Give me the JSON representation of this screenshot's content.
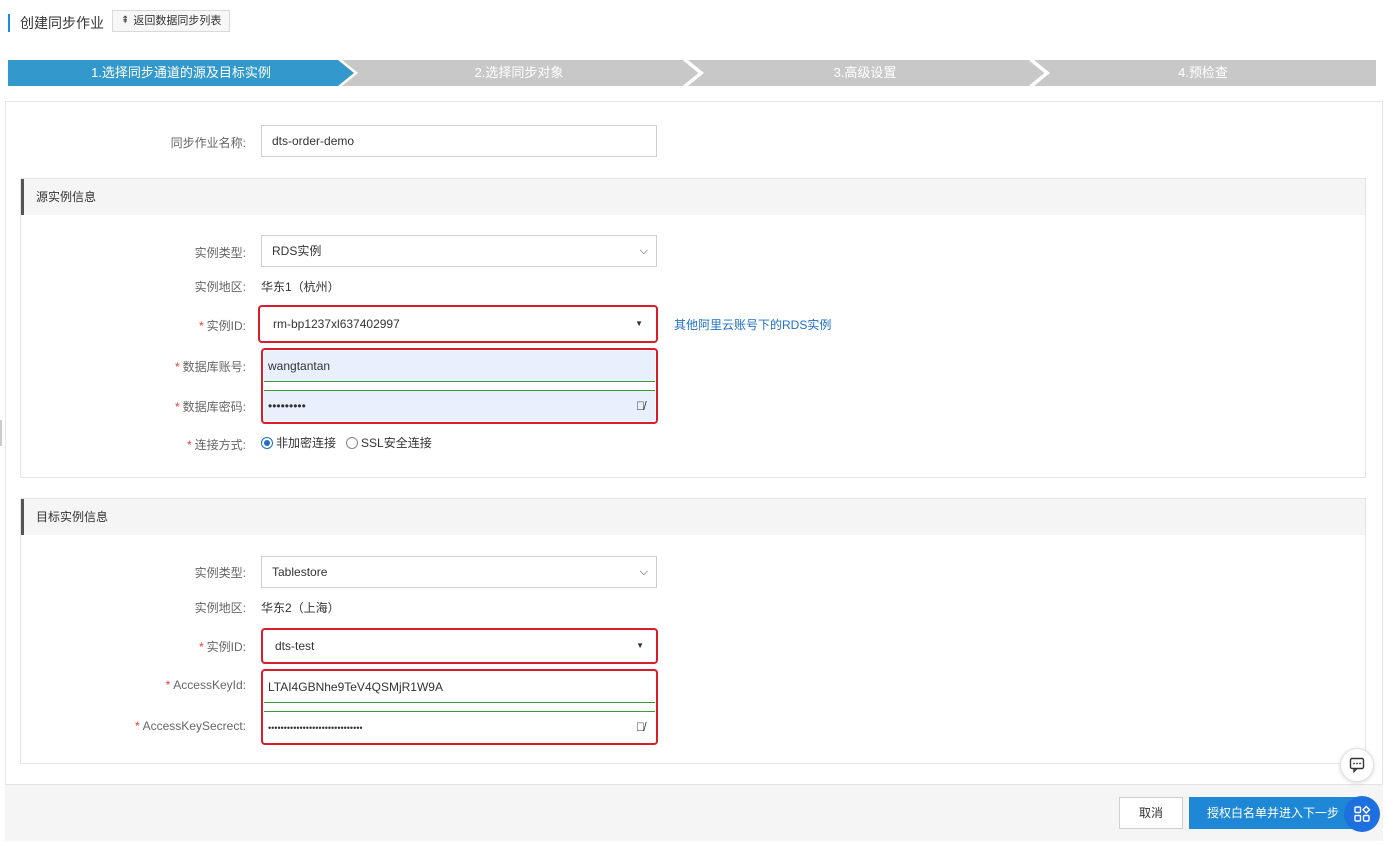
{
  "header": {
    "title": "创建同步作业",
    "back_label": "返回数据同步列表",
    "back_icon": "upload-arrow-icon"
  },
  "steps": [
    {
      "label": "1.选择同步通道的源及目标实例",
      "active": true
    },
    {
      "label": "2.选择同步对象",
      "active": false
    },
    {
      "label": "3.高级设置",
      "active": false
    },
    {
      "label": "4.预检查",
      "active": false
    }
  ],
  "colors": {
    "step_active": "#3399cc",
    "step_inactive": "#c8c8c8",
    "highlight_border": "#d91d2a",
    "primary_button": "#1e88d6",
    "link": "#1e6fc8"
  },
  "job": {
    "name_label": "同步作业名称:",
    "name_value": "dts-order-demo"
  },
  "source": {
    "section_title": "源实例信息",
    "type_label": "实例类型:",
    "type_value": "RDS实例",
    "region_label": "实例地区:",
    "region_value": "华东1（杭州）",
    "id_label": "实例ID:",
    "id_value": "rm-bp1237xl637402997",
    "other_account_link": "其他阿里云账号下的RDS实例",
    "account_label": "数据库账号:",
    "account_value": "wangtantan",
    "password_label": "数据库密码:",
    "password_value": "•••••••••",
    "connection_label": "连接方式:",
    "connection_options": [
      "非加密连接",
      "SSL安全连接"
    ],
    "connection_selected": "非加密连接"
  },
  "target": {
    "section_title": "目标实例信息",
    "type_label": "实例类型:",
    "type_value": "Tablestore",
    "region_label": "实例地区:",
    "region_value": "华东2（上海）",
    "id_label": "实例ID:",
    "id_value": "dts-test",
    "access_key_id_label": "AccessKeyId:",
    "access_key_id_value": "LTAI4GBNhe9TeV4QSMjR1W9A",
    "access_key_secret_label": "AccessKeySecrect:",
    "access_key_secret_value": "••••••••••••••••••••••••••••••"
  },
  "footer": {
    "cancel_label": "取消",
    "next_label": "授权白名单并进入下一步"
  },
  "icons": {
    "eye": "eye-slash-icon",
    "chat": "chat-icon",
    "apps": "apps-icon"
  }
}
